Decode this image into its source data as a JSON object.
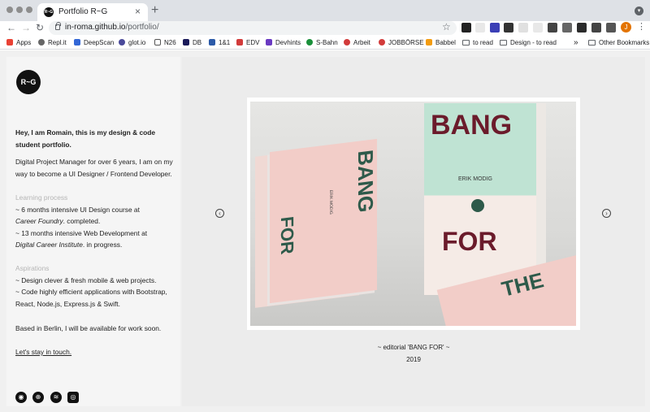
{
  "browser": {
    "tab_title": "Portfolio R~G",
    "tab_favicon_text": "R~G",
    "tab_close": "×",
    "new_tab": "+",
    "back": "←",
    "forward": "→",
    "reload": "↻",
    "url_host": "in-roma.github.io",
    "url_path": "/portfolio/",
    "star": "☆",
    "profile_initial": "J",
    "menu": "⋮",
    "overflow": "»"
  },
  "bookmarks": [
    {
      "label": "Apps",
      "icon": "apps-grid-icon",
      "color": "#e94235"
    },
    {
      "label": "Repl.it",
      "icon": "replit-icon",
      "color": "#666666"
    },
    {
      "label": "DeepScan",
      "icon": "deepscan-icon",
      "color": "#3367d6"
    },
    {
      "label": "glot.io",
      "icon": "glot-icon",
      "color": "#4a4a9a"
    },
    {
      "label": "N26",
      "icon": "n26-icon",
      "color": "#555555"
    },
    {
      "label": "DB",
      "icon": "db-icon",
      "color": "#1a1a5a"
    },
    {
      "label": "1&1",
      "icon": "oneandone-icon",
      "color": "#2b5aa8"
    },
    {
      "label": "EDV",
      "icon": "edv-icon",
      "color": "#d23b3b"
    },
    {
      "label": "Devhints",
      "icon": "devhints-icon",
      "color": "#6a3ac2"
    },
    {
      "label": "S-Bahn",
      "icon": "sbahn-icon",
      "color": "#1a8f3a"
    },
    {
      "label": "Arbeit",
      "icon": "arbeit-icon",
      "color": "#d23b3b"
    },
    {
      "label": "JOBBÖRSE",
      "icon": "jobboerse-icon",
      "color": "#d23b3b"
    },
    {
      "label": "Babbel",
      "icon": "babbel-icon",
      "color": "#f39c12"
    },
    {
      "label": "to read",
      "icon": "folder-icon",
      "color": ""
    },
    {
      "label": "Design - to read",
      "icon": "folder-icon",
      "color": ""
    }
  ],
  "other_bookmarks": "Other Bookmarks",
  "sidebar": {
    "logo_text": "R~G",
    "intro_line1": "Hey, I am Romain, this is my design & code",
    "intro_line2": "student portfolio.",
    "bio_line1": "Digital Project Manager for over 6 years, I am on my",
    "bio_line2": "way to become a UI Designer / Frontend Developer.",
    "learning_heading": "Learning process",
    "learning_1a": "~ 6 months intensive UI Design course at",
    "learning_1b": "Career Foundry",
    "learning_1c": ". completed.",
    "learning_2a": "~ 13 months intensive Web Development at",
    "learning_2b": "Digital Career Institute",
    "learning_2c": ". in progress.",
    "aspirations_heading": "Aspirations",
    "aspiration_1": "~ Design clever & fresh mobile & web projects.",
    "aspiration_2a": "~ Code highly efficient applications with Bootstrap,",
    "aspiration_2b": "React, Node.js, Express.js & Swift.",
    "location": "Based in Berlin, I will be available for work soon.",
    "contact_link": "Let's stay in touch.",
    "social": [
      "github-icon",
      "dribbble-icon",
      "spotify-icon",
      "instagram-icon"
    ]
  },
  "gallery": {
    "prev_arrow": "‹",
    "next_arrow": "›",
    "caption_title": "~ editorial 'BANG FOR' ~",
    "caption_year": "2019",
    "book_word_1": "BANG",
    "book_word_2": "FOR",
    "book_word_3": "THE",
    "book_author": "ERIK MODIG"
  },
  "colors": {
    "accent_orange": "#e37400",
    "book_pink": "#f2cdc8",
    "book_mint": "#bfe3d3",
    "book_ink_green": "#2e5a4a",
    "book_ink_maroon": "#6b1b2b"
  }
}
